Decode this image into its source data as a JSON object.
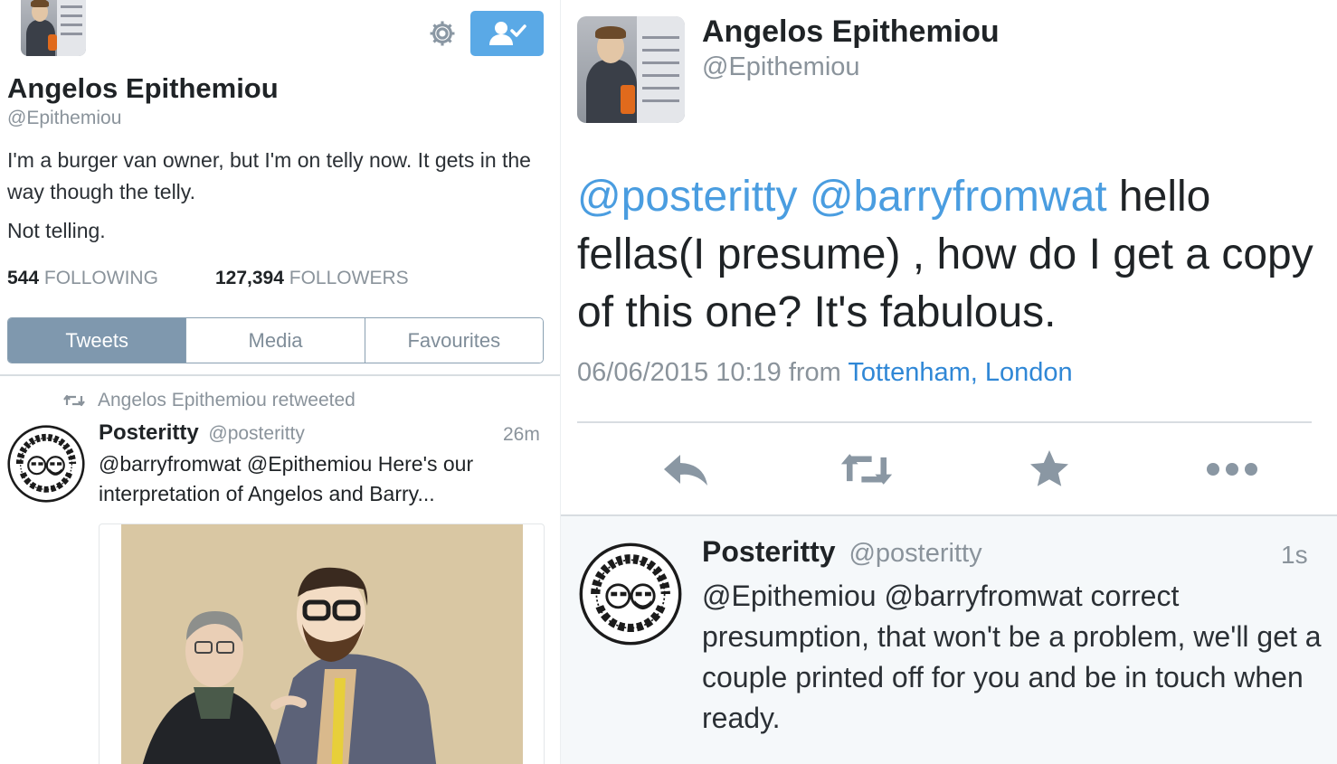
{
  "left": {
    "profile": {
      "name": "Angelos Epithemiou",
      "handle": "@Epithemiou",
      "bio": "I'm a burger van owner, but I'm on telly now. It gets in the way though the telly.",
      "location": "Not telling.",
      "following_count": "544",
      "following_label": "FOLLOWING",
      "followers_count": "127,394",
      "followers_label": "FOLLOWERS",
      "settings_icon": "gear-icon",
      "follow_icon": "user-check-icon",
      "follow_button_color": "#5aa9e6"
    },
    "tabs": [
      {
        "label": "Tweets",
        "active": true
      },
      {
        "label": "Media",
        "active": false
      },
      {
        "label": "Favourites",
        "active": false
      }
    ],
    "retweet_notice": "Angelos Epithemiou retweeted",
    "post": {
      "name": "Posteritty",
      "handle": "@posteritty",
      "time": "26m",
      "text": "@barryfromwat @Epithemiou Here's our interpretation of Angelos and Barry...",
      "avatar_lettering": "POSTERITTY ORIGINAL"
    }
  },
  "right": {
    "author": {
      "name": "Angelos Epithemiou",
      "handle": "@Epithemiou"
    },
    "tweet": {
      "mention1": "@posteritty",
      "mention2": "@barryfromwat",
      "text": " hello fellas(I presume) , how do I get a copy of this one? It's fabulous.",
      "meta": "06/06/2015 10:19 from ",
      "place": "Tottenham, London",
      "link_color": "#4a9de0"
    },
    "actions": [
      "reply-icon",
      "retweet-icon",
      "favourite-star-icon",
      "more-dots-icon"
    ],
    "reply": {
      "name": "Posteritty",
      "handle": "@posteritty",
      "time": "1s",
      "text": "@Epithemiou @barryfromwat correct presumption, that won't be a problem, we'll get a couple printed off for you and be in touch when ready.",
      "avatar_lettering": "POSTERITTY ORIGINAL"
    }
  }
}
